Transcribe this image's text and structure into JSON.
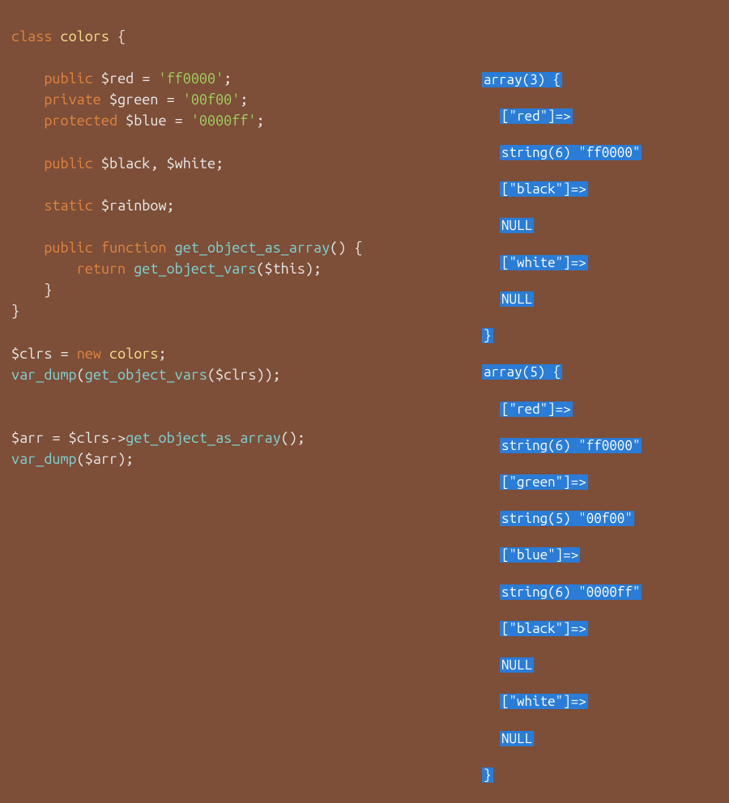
{
  "code": {
    "l1": {
      "kw_class": "class",
      "cls": "colors",
      "brace_open": "{"
    },
    "l3": {
      "vis": "public",
      "var": "$red",
      "eq": "=",
      "str": "'ff0000'",
      "semi": ";"
    },
    "l4": {
      "vis": "private",
      "var": "$green",
      "eq": "=",
      "str": "'00f00'",
      "semi": ";"
    },
    "l5": {
      "vis": "protected",
      "var": "$blue",
      "eq": "=",
      "str": "'0000ff'",
      "semi": ";"
    },
    "l7": {
      "vis": "public",
      "var1": "$black",
      "comma": ",",
      "var2": "$white",
      "semi": ";"
    },
    "l9": {
      "kw_static": "static",
      "var": "$rainbow",
      "semi": ";"
    },
    "l11": {
      "vis": "public",
      "kw_fn": "function",
      "fname": "get_object_as_array",
      "paren": "()",
      "brace": "{"
    },
    "l12": {
      "kw_return": "return",
      "call": "get_object_vars",
      "arg": "$this"
    },
    "l13": {
      "brace_close": "}"
    },
    "l14": {
      "brace_close": "}"
    },
    "l16": {
      "var": "$clrs",
      "eq": "=",
      "kw_new": "new",
      "cls": "colors",
      "semi": ";"
    },
    "l17": {
      "fn": "var_dump",
      "inner": "get_object_vars",
      "arg": "$clrs"
    },
    "l20": {
      "var": "$arr",
      "eq": "=",
      "obj": "$clrs",
      "arrow": "->",
      "method": "get_object_as_array",
      "paren": "()",
      "semi": ";"
    },
    "l21": {
      "fn": "var_dump",
      "arg": "$arr"
    }
  },
  "output": {
    "a1_header": "array(3) {",
    "a1_k_red": "[\"red\"]=>",
    "a1_v_red": "string(6) \"ff0000\"",
    "a1_k_black": "[\"black\"]=>",
    "a1_v_black": "NULL",
    "a1_k_white": "[\"white\"]=>",
    "a1_v_white": "NULL",
    "a1_close": "}",
    "a2_header": "array(5) {",
    "a2_k_red": "[\"red\"]=>",
    "a2_v_red": "string(6) \"ff0000\"",
    "a2_k_green": "[\"green\"]=>",
    "a2_v_green": "string(5) \"00f00\"",
    "a2_k_blue": "[\"blue\"]=>",
    "a2_v_blue": "string(6) \"0000ff\"",
    "a2_k_black": "[\"black\"]=>",
    "a2_v_black": "NULL",
    "a2_k_white": "[\"white\"]=>",
    "a2_v_white": "NULL",
    "a2_close": "}"
  }
}
